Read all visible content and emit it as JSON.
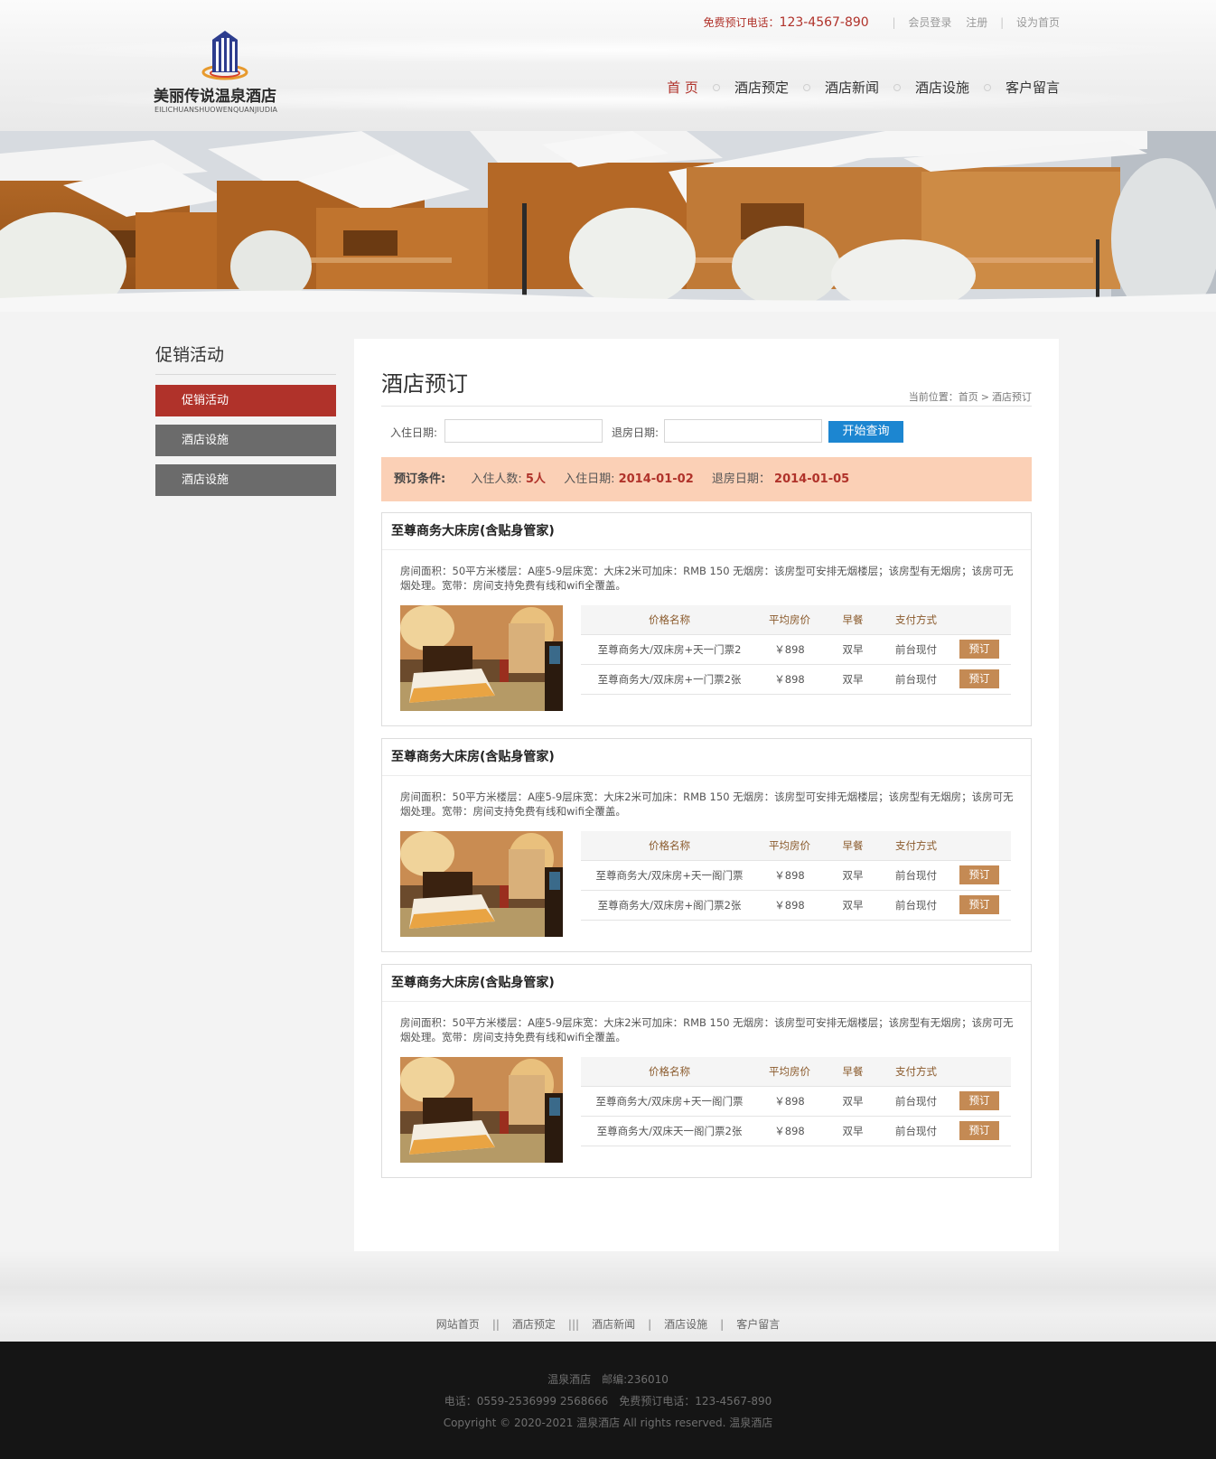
{
  "header": {
    "hotline_label": "免费预订电话：",
    "hotline_number": "123-4567-890",
    "links": [
      "会员登录",
      "注册",
      "设为首页"
    ],
    "logo_name": "美丽传说温泉酒店",
    "logo_pinyin": "EILICHUANSHUOWENQUANJIUDIA",
    "nav": [
      "首 页",
      "酒店预定",
      "酒店新闻",
      "酒店设施",
      "客户留言"
    ],
    "active_nav_index": 0
  },
  "sidebar": {
    "title": "促销活动",
    "items": [
      "促销活动",
      "酒店设施",
      "酒店设施"
    ],
    "active_index": 0
  },
  "content": {
    "title": "酒店预订",
    "breadcrumb_label": "当前位置：",
    "breadcrumb_home": "首页",
    "breadcrumb_sep": ">",
    "breadcrumb_current": "酒店预订",
    "search": {
      "checkin_label": "入住日期:",
      "checkin_value": "",
      "checkout_label": "退房日期:",
      "checkout_value": "",
      "button": "开始查询"
    },
    "conditions": {
      "label": "预订条件:",
      "guests_label": "入住人数:",
      "guests_value": "5人",
      "checkin_label": "入住日期:",
      "checkin_value": "2014-01-02",
      "checkout_label": "退房日期：",
      "checkout_value": "2014-01-05"
    },
    "table_headers": [
      "价格名称",
      "平均房价",
      "早餐",
      "支付方式"
    ],
    "book_label": "预订",
    "rooms": [
      {
        "title": "至尊商务大床房(含贴身管家)",
        "desc": "房间面积：50平方米楼层：A座5-9层床宽：大床2米可加床：RMB 150 无烟房：该房型可安排无烟楼层；该房型有无烟房；该房可无烟处理。宽带：房间支持免费有线和wifi全覆盖。",
        "rows": [
          {
            "name": "至尊商务大/双床房+天一门票2",
            "price": "￥898",
            "breakfast": "双早",
            "payment": "前台现付"
          },
          {
            "name": "至尊商务大/双床房+一门票2张",
            "price": "￥898",
            "breakfast": "双早",
            "payment": "前台现付"
          }
        ]
      },
      {
        "title": "至尊商务大床房(含贴身管家)",
        "desc": "房间面积：50平方米楼层：A座5-9层床宽：大床2米可加床：RMB 150 无烟房：该房型可安排无烟楼层；该房型有无烟房；该房可无烟处理。宽带：房间支持免费有线和wifi全覆盖。",
        "rows": [
          {
            "name": "至尊商务大/双床房+天一阁门票",
            "price": "￥898",
            "breakfast": "双早",
            "payment": "前台现付"
          },
          {
            "name": "至尊商务大/双床房+阁门票2张",
            "price": "￥898",
            "breakfast": "双早",
            "payment": "前台现付"
          }
        ]
      },
      {
        "title": "至尊商务大床房(含贴身管家)",
        "desc": "房间面积：50平方米楼层：A座5-9层床宽：大床2米可加床：RMB 150 无烟房：该房型可安排无烟楼层；该房型有无烟房；该房可无烟处理。宽带：房间支持免费有线和wifi全覆盖。",
        "rows": [
          {
            "name": "至尊商务大/双床房+天一阁门票",
            "price": "￥898",
            "breakfast": "双早",
            "payment": "前台现付"
          },
          {
            "name": "至尊商务大/双床天一阁门票2张",
            "price": "￥898",
            "breakfast": "双早",
            "payment": "前台现付"
          }
        ]
      }
    ]
  },
  "footer": {
    "nav": [
      "网站首页",
      "酒店预定",
      "酒店新闻",
      "酒店设施",
      "客户留言"
    ],
    "nav_separators": [
      "||",
      "|||",
      "|",
      "|"
    ],
    "line1": "温泉酒店　邮编:236010",
    "line2": "电话：0559-2536999  2568666　免费预订电话：123-4567-890",
    "line3": "Copyright © 2020-2021 温泉酒店  All rights reserved.  温泉酒店"
  },
  "colors": {
    "brand_red": "#b0322a",
    "button_blue": "#1c86d1",
    "book_button": "#c48a54",
    "condition_bg": "#fbd0b6",
    "sidebar_gray": "#6b6b6b",
    "footer_bg": "#151515"
  },
  "icons": {
    "logo": "hotel-building-logo-icon"
  }
}
